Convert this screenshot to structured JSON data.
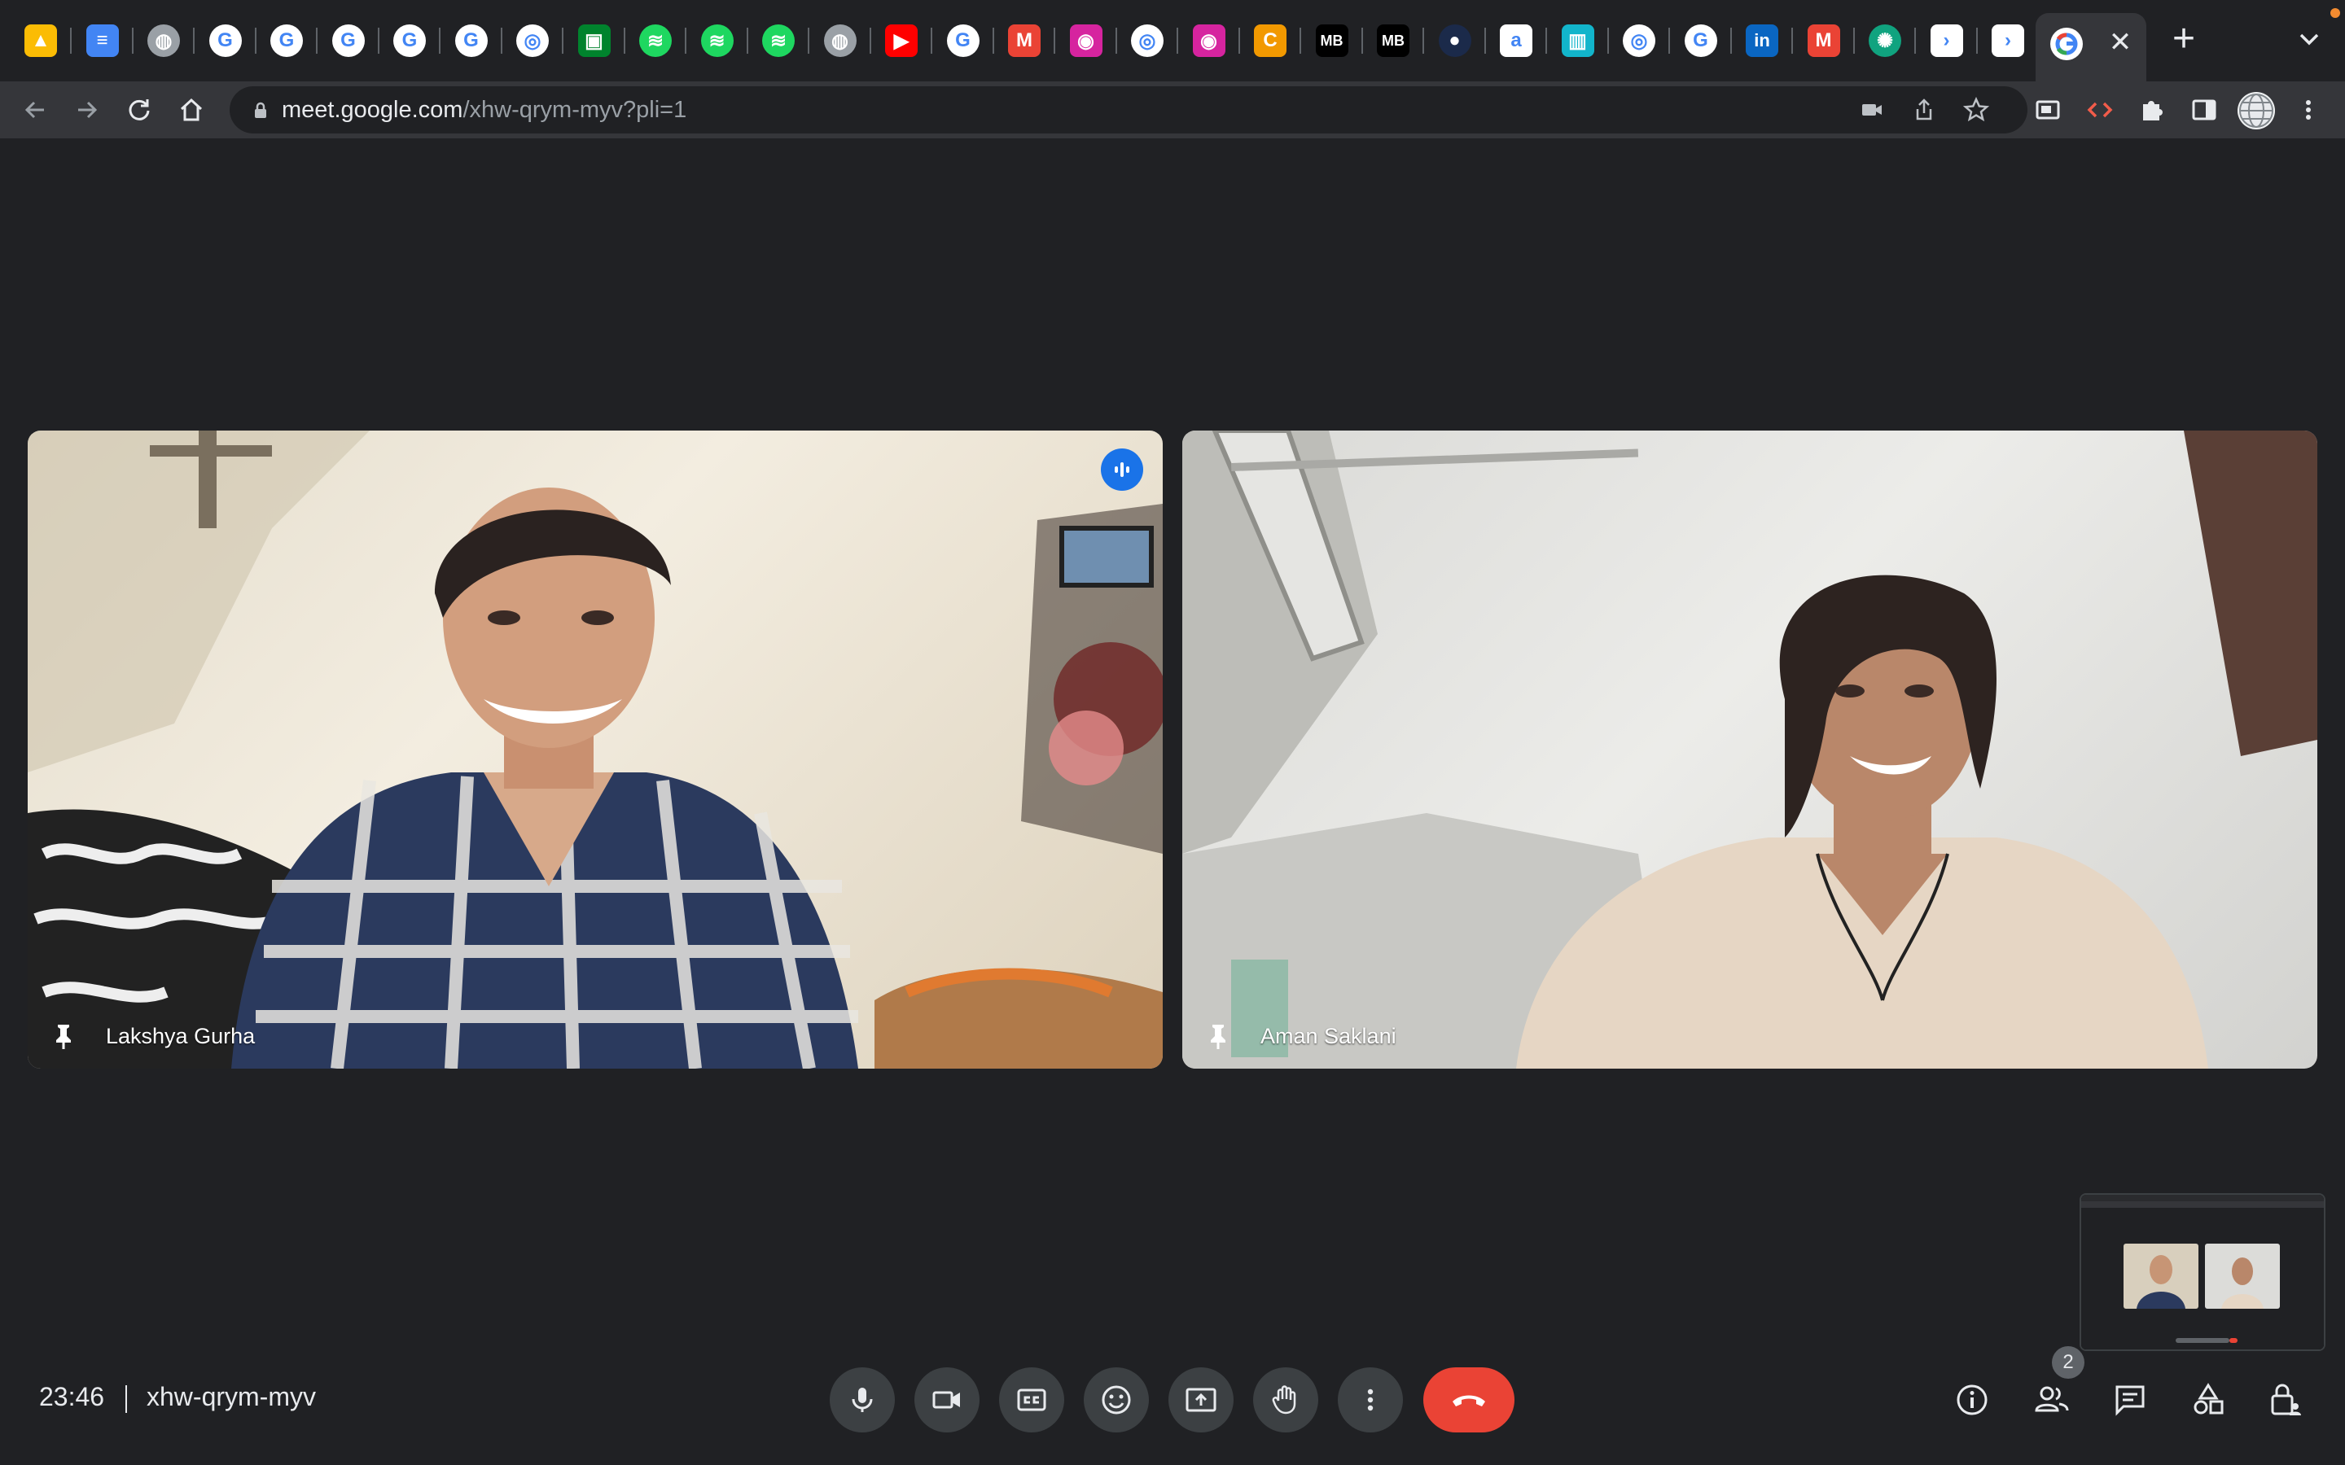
{
  "browser": {
    "tabs": [
      {
        "icon": "google-drive-icon",
        "color": "#fbbc04"
      },
      {
        "icon": "google-docs-icon",
        "color": "#4285f4"
      },
      {
        "icon": "globe-icon",
        "color": "#9aa0a6"
      },
      {
        "icon": "google-g-icon",
        "color": "#ffffff"
      },
      {
        "icon": "google-g-icon",
        "color": "#ffffff"
      },
      {
        "icon": "google-g-icon",
        "color": "#ffffff"
      },
      {
        "icon": "google-g-icon",
        "color": "#ffffff"
      },
      {
        "icon": "google-g-icon",
        "color": "#ffffff"
      },
      {
        "icon": "chrome-icon",
        "color": "#ffffff"
      },
      {
        "icon": "google-meet-icon",
        "color": "#00832d"
      },
      {
        "icon": "spotify-icon",
        "color": "#1ed760"
      },
      {
        "icon": "spotify-icon",
        "color": "#1ed760"
      },
      {
        "icon": "spotify-icon",
        "color": "#1ed760"
      },
      {
        "icon": "globe-icon",
        "color": "#9aa0a6"
      },
      {
        "icon": "youtube-icon",
        "color": "#ff0000"
      },
      {
        "icon": "google-g-icon",
        "color": "#ffffff"
      },
      {
        "icon": "gmail-icon",
        "color": "#ea4335"
      },
      {
        "icon": "instagram-icon",
        "color": "#d6249f"
      },
      {
        "icon": "chrome-icon",
        "color": "#ffffff"
      },
      {
        "icon": "instagram-icon",
        "color": "#d6249f"
      },
      {
        "icon": "c-app-icon",
        "color": "#f29900"
      },
      {
        "icon": "mb-icon",
        "color": "#000000"
      },
      {
        "icon": "mb-icon",
        "color": "#000000"
      },
      {
        "icon": "dark-circle-icon",
        "color": "#1b2a4a"
      },
      {
        "icon": "amazon-icon",
        "color": "#ffffff"
      },
      {
        "icon": "chart-app-icon",
        "color": "#12b5cb"
      },
      {
        "icon": "chrome-icon",
        "color": "#ffffff"
      },
      {
        "icon": "google-g-icon",
        "color": "#ffffff"
      },
      {
        "icon": "linkedin-icon",
        "color": "#0a66c2"
      },
      {
        "icon": "gmail-icon",
        "color": "#ea4335"
      },
      {
        "icon": "openai-icon",
        "color": "#10a37f"
      },
      {
        "icon": "chevron-app-icon",
        "color": "#ffffff"
      },
      {
        "icon": "chevron-app-icon",
        "color": "#ffffff"
      },
      {
        "icon": "google-g-icon",
        "color": "#ffffff"
      }
    ],
    "active_tab": {
      "icon": "google-g-icon",
      "close_glyph": "✕"
    },
    "new_tab_glyph": "+",
    "url_host": "meet.google.com",
    "url_path": "/xhw-qrym-myv?pli=1"
  },
  "meeting": {
    "participants": [
      {
        "name": "Lakshya Gurha",
        "speaking": true
      },
      {
        "name": "Aman Saklani",
        "speaking": false
      }
    ],
    "time": "23:46",
    "code": "xhw-qrym-myv",
    "people_count": "2"
  },
  "colors": {
    "background": "#202124",
    "control_bg": "#3c4043",
    "end_call": "#ea4335",
    "speaking": "#1a73e8"
  }
}
